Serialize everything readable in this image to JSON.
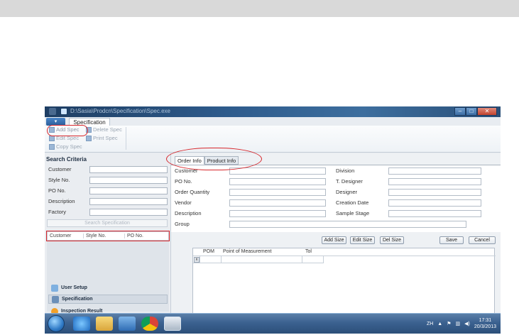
{
  "window": {
    "title": "D:\\Sasia\\Prodcn\\Specification\\Spec.exe"
  },
  "ribbon": {
    "app_menu_glyph": "▾",
    "tab_label": "Specification",
    "buttons": {
      "add_spec": "Add Spec",
      "edit_spec": "Edit Spec",
      "copy_spec": "Copy Spec",
      "delete_spec": "Delete Spec",
      "print_spec": "Print Spec"
    }
  },
  "search": {
    "heading": "Search Criteria",
    "labels": {
      "customer": "Customer",
      "style_no": "Style No.",
      "po_no": "PO No.",
      "description": "Description",
      "factory": "Factory"
    },
    "button": "Search Specification",
    "results_headers": [
      "Customer",
      "Style No.",
      "PO No."
    ]
  },
  "nav": {
    "user_setup": "User Setup",
    "specification": "Specification",
    "inspection_result": "Inspection Result"
  },
  "tabs": {
    "order_info": "Order Info",
    "product_info": "Product Info"
  },
  "form": {
    "customer": "Customer",
    "po_no": "PO No.",
    "order_quantity": "Order Quantity",
    "vendor": "Vendor",
    "description": "Description",
    "group": "Group",
    "division": "Division",
    "t_designer": "T. Designer",
    "designer": "Designer",
    "creation_date": "Creation Date",
    "sample_stage": "Sample Stage"
  },
  "actions": {
    "add_size": "Add Size",
    "edit_size": "Edit Size",
    "del_size": "Del Size",
    "save": "Save",
    "cancel": "Cancel"
  },
  "grid": {
    "headers": {
      "pom": "POM",
      "point_of_measurement": "Point of Measurement",
      "tol": "Tol"
    },
    "row_delete_glyph": "x"
  },
  "taskbar": {
    "lang": "ZH",
    "time": "17:31",
    "date": "20/3/2013"
  },
  "colors": {
    "highlight": "#d7262b",
    "titlebar": "#2e5b8c",
    "taskbar": "#3b6190"
  },
  "icons": [
    "app-icon",
    "add-spec-icon",
    "edit-spec-icon",
    "copy-spec-icon",
    "delete-spec-icon",
    "print-spec-icon",
    "user-setup-icon",
    "specification-icon",
    "inspection-result-icon",
    "windows-start-icon",
    "ie-icon",
    "folder-icon",
    "media-icon",
    "chrome-icon",
    "app-taskbar-icon"
  ]
}
